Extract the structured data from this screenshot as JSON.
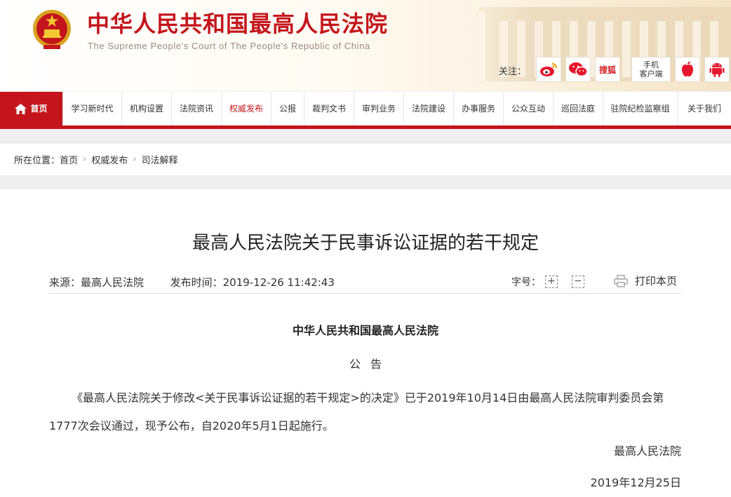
{
  "header": {
    "title": "中华人民共和国最高人民法院",
    "subtitle": "The Supreme People's Court of The People's Republic of China",
    "follow_label": "关注：",
    "social": [
      {
        "name": "weibo-icon"
      },
      {
        "name": "wechat-icon"
      },
      {
        "name": "sohu-icon",
        "label": "搜狐"
      },
      {
        "name": "mobile-client",
        "line1": "手机",
        "line2": "客户端"
      },
      {
        "name": "apple-icon"
      },
      {
        "name": "android-icon"
      }
    ]
  },
  "nav": {
    "items": [
      "首页",
      "学习新时代",
      "机构设置",
      "法院资讯",
      "权威发布",
      "公报",
      "裁判文书",
      "审判业务",
      "法院建设",
      "办事服务",
      "公众互动",
      "巡回法庭",
      "驻院纪检监察组",
      "关于我们"
    ]
  },
  "breadcrumb": {
    "prefix": "所在位置：",
    "items": [
      "首页",
      "权威发布",
      "司法解释"
    ]
  },
  "article": {
    "title": "最高人民法院关于民事诉讼证据的若干规定",
    "source_label": "来源：",
    "source": "最高人民法院",
    "time_label": "发布时间：",
    "time": "2019-12-26 11:42:43",
    "font_size_label": "字号：",
    "font_plus": "+",
    "font_minus": "−",
    "print_label": "打印本页",
    "org": "中华人民共和国最高人民法院",
    "notice": "公告",
    "body": "《最高人民法院关于修改<关于民事诉讼证据的若干规定>的决定》已于2019年10月14日由最高人民法院审判委员会第1777次会议通过，现予公布，自2020年5月1日起施行。",
    "signature": "最高人民法院",
    "date": "2019年12月25日"
  },
  "colors": {
    "brand_red": "#c4151c",
    "title_red": "#c4151c"
  }
}
